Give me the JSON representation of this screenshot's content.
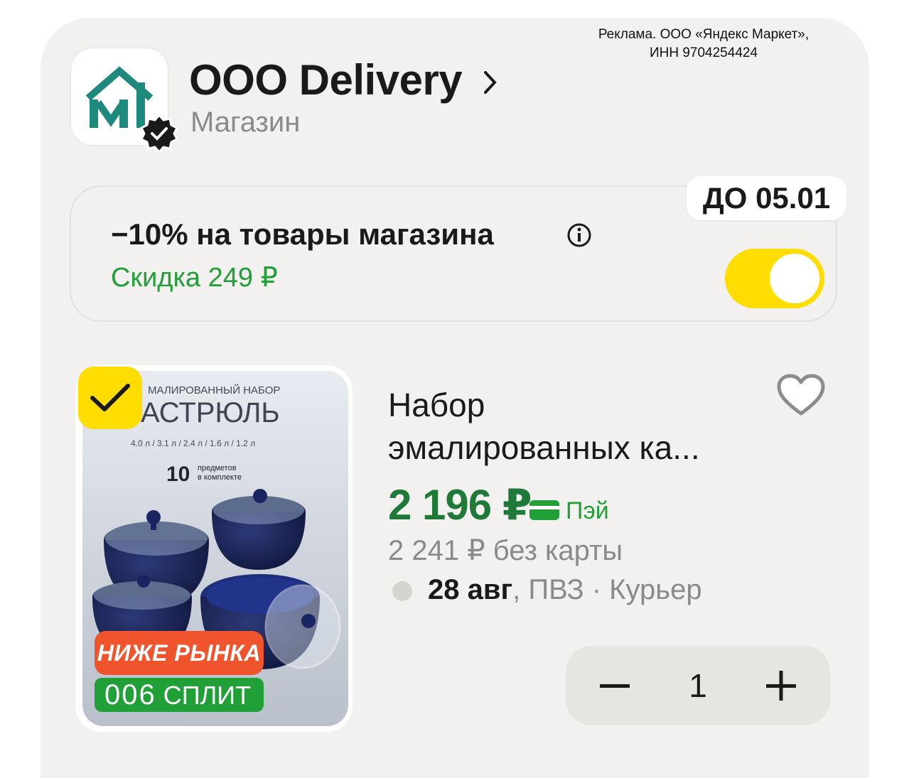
{
  "ad": {
    "line1": "Реклама. ООО «Яндекс Маркет»,",
    "line2": "ИНН 9704254424"
  },
  "shop": {
    "name": "ООО Delivery",
    "subtitle": "Магазин",
    "logo_icon": "shop-logo-mi",
    "verified_icon": "verified-badge-icon"
  },
  "promo": {
    "title": "−10% на товары магазина",
    "discount": "Скидка 249 ₽",
    "deadline": "ДО 05.01",
    "toggle_on": true
  },
  "product": {
    "title_line1": "Набор",
    "title_line2": "эмалированных ка...",
    "price": "2 196 ₽",
    "pay_label": "Пэй",
    "old_price": "2 241 ₽ без карты",
    "delivery_date": "28 авг",
    "delivery_rest": ", ПВЗ · Курьер",
    "quantity": "1",
    "selected": true,
    "badge_market": "НИЖЕ РЫНКА",
    "badge_split_prefix": "006",
    "badge_split_label": "СПЛИТ",
    "image_texts": {
      "line1": "МАЛИРОВАННЫЙ НАБОР",
      "line2": "АСТРЮЛЬ",
      "volumes": "4.0 л / 3.1 л / 2.4 л / 1.6 л / 1.2 л",
      "count": "10",
      "count_label1": "предметов",
      "count_label2": "в комплекте"
    }
  },
  "colors": {
    "accent_yellow": "#ffdd00",
    "green": "#21a038",
    "price_green": "#1f7a3a",
    "badge_red": "#f0542d"
  }
}
